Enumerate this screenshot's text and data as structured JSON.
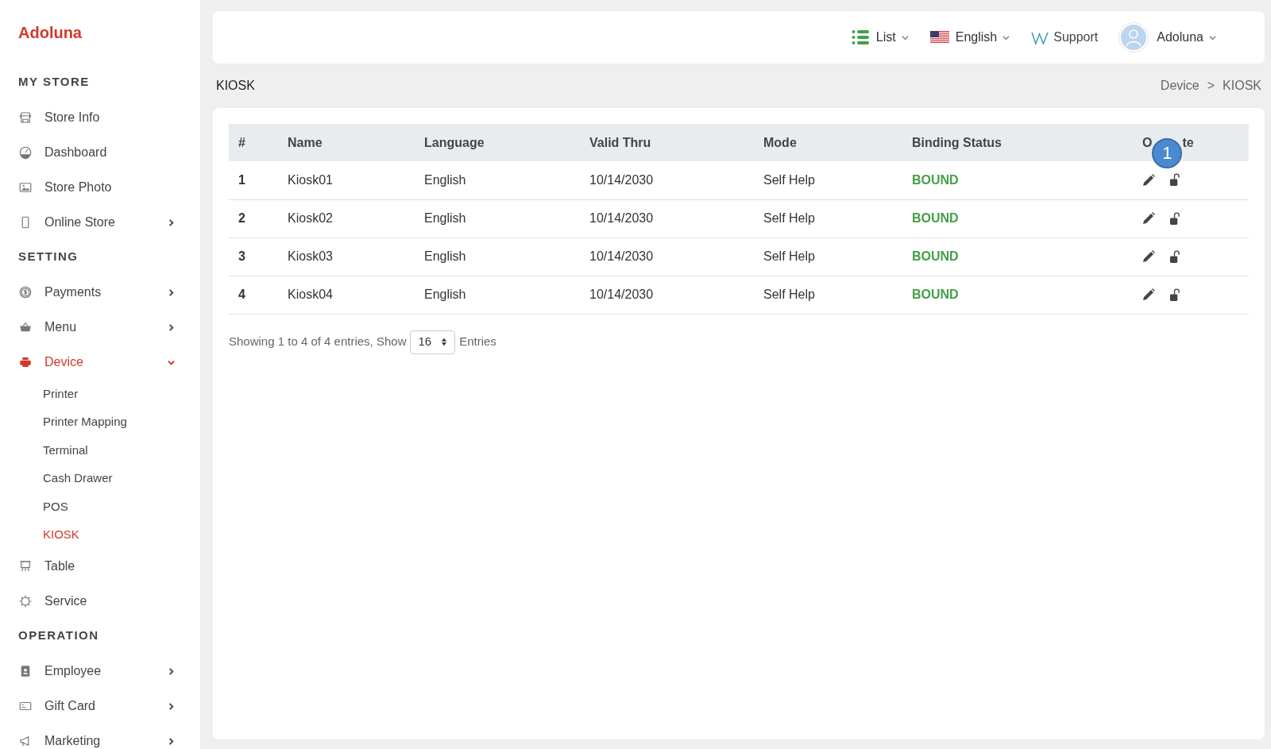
{
  "brand": "Adoluna",
  "sidebar": {
    "sections": [
      {
        "heading": "MY STORE",
        "items": [
          {
            "label": "Store Info",
            "selected": false
          },
          {
            "label": "Dashboard",
            "selected": false
          },
          {
            "label": "Store Photo",
            "selected": false
          },
          {
            "label": "Online Store",
            "selected": false,
            "expanded": false
          }
        ]
      },
      {
        "heading": "SETTING",
        "items": [
          {
            "label": "Payments",
            "selected": false,
            "expanded": false
          },
          {
            "label": "Menu",
            "selected": false,
            "expanded": false
          },
          {
            "label": "Device",
            "selected": true,
            "expanded": true,
            "children": [
              {
                "label": "Printer",
                "selected": false
              },
              {
                "label": "Printer Mapping",
                "selected": false
              },
              {
                "label": "Terminal",
                "selected": false
              },
              {
                "label": "Cash Drawer",
                "selected": false
              },
              {
                "label": "POS",
                "selected": false
              },
              {
                "label": "KIOSK",
                "selected": true
              }
            ]
          },
          {
            "label": "Table",
            "selected": false
          },
          {
            "label": "Service",
            "selected": false
          }
        ]
      },
      {
        "heading": "OPERATION",
        "items": [
          {
            "label": "Employee",
            "selected": false,
            "expanded": false
          },
          {
            "label": "Gift Card",
            "selected": false,
            "expanded": false
          },
          {
            "label": "Marketing",
            "selected": false,
            "expanded": false
          }
        ]
      }
    ]
  },
  "topbar": {
    "view": "List",
    "language": "English",
    "support": "Support",
    "user": "Adoluna"
  },
  "page_title": "KIOSK",
  "breadcrumb": {
    "items": [
      "Device",
      "KIOSK"
    ],
    "separator": ">"
  },
  "table": {
    "columns": [
      "#",
      "Name",
      "Language",
      "Valid Thru",
      "Mode",
      "Binding Status"
    ],
    "last_column": {
      "visible_start": "O",
      "visible_end": "te"
    },
    "step_badge": "1",
    "rows": [
      {
        "num": "1",
        "name": "Kiosk01",
        "language": "English",
        "valid_thru": "10/14/2030",
        "mode": "Self Help",
        "status": "BOUND"
      },
      {
        "num": "2",
        "name": "Kiosk02",
        "language": "English",
        "valid_thru": "10/14/2030",
        "mode": "Self Help",
        "status": "BOUND"
      },
      {
        "num": "3",
        "name": "Kiosk03",
        "language": "English",
        "valid_thru": "10/14/2030",
        "mode": "Self Help",
        "status": "BOUND"
      },
      {
        "num": "4",
        "name": "Kiosk04",
        "language": "English",
        "valid_thru": "10/14/2030",
        "mode": "Self Help",
        "status": "BOUND"
      }
    ]
  },
  "footer": {
    "summary": "Showing 1 to 4 of 4 entries, Show",
    "page_size": "16",
    "suffix": "Entries"
  }
}
